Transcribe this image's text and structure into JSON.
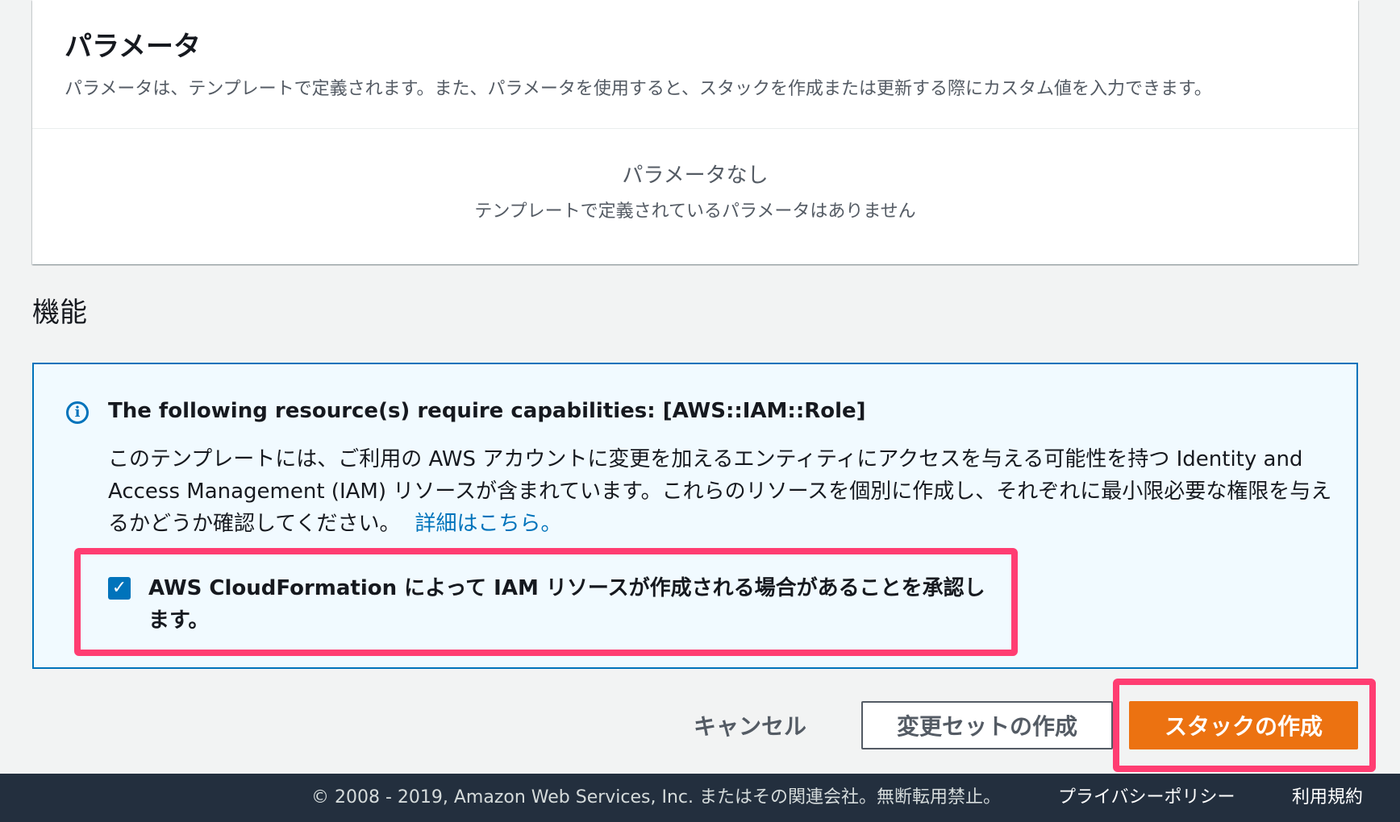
{
  "parameters": {
    "title": "パラメータ",
    "description": "パラメータは、テンプレートで定義されます。また、パラメータを使用すると、スタックを作成または更新する際にカスタム値を入力できます。",
    "empty_title": "パラメータなし",
    "empty_description": "テンプレートで定義されているパラメータはありません"
  },
  "capabilities": {
    "heading": "機能",
    "alert_icon": "info-icon",
    "alert_title": "The following resource(s) require capabilities: [AWS::IAM::Role]",
    "alert_body": "このテンプレートには、ご利用の AWS アカウントに変更を加えるエンティティにアクセスを与える可能性を持つ Identity and Access Management (IAM) リソースが含まれています。これらのリソースを個別に作成し、それぞれに最小限必要な権限を与えるかどうか確認してください。",
    "learn_more_link": "詳細はこちら。",
    "acknowledge_label": "AWS CloudFormation によって IAM リソースが作成される場合があることを承認します。",
    "acknowledge_checked": true
  },
  "actions": {
    "cancel_label": "キャンセル",
    "changeset_label": "変更セットの作成",
    "create_label": "スタックの作成"
  },
  "footer": {
    "copyright": "© 2008 - 2019, Amazon Web Services, Inc. またはその関連会社。無断転用禁止。",
    "privacy_link": "プライバシーポリシー",
    "terms_link": "利用規約"
  },
  "colors": {
    "accent_blue": "#0073bb",
    "primary_orange": "#ec7211",
    "highlight_pink": "#ff3d72",
    "footer_bg": "#232f3e"
  }
}
